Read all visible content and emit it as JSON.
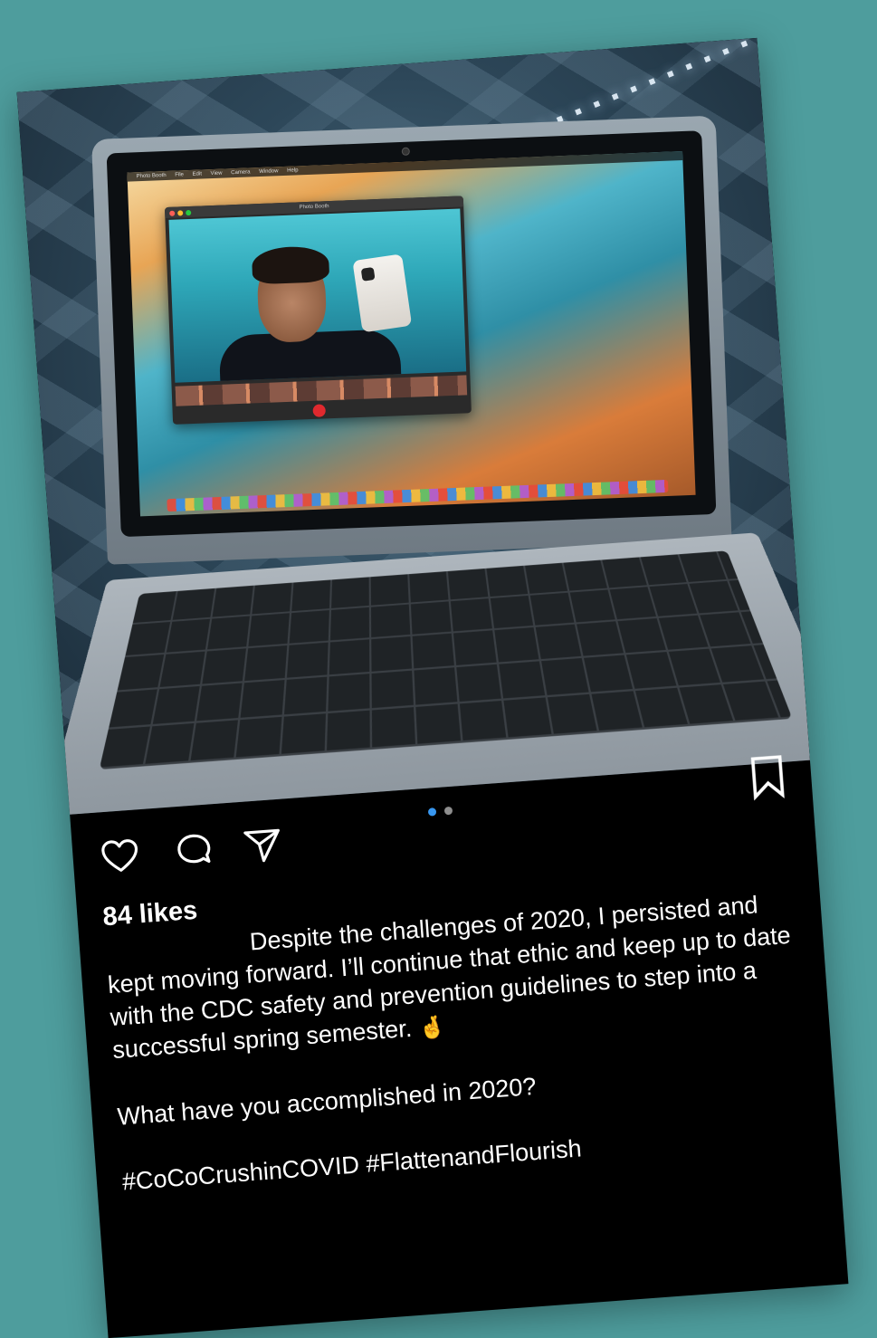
{
  "post": {
    "likes_text": "84 likes",
    "caption": "Despite the challenges of 2020, I persisted and kept moving forward. I’ll continue that ethic and keep up to date with the CDC safety and prevention guidelines to step into a successful spring semester.",
    "emoji": "🤞",
    "question": "What have you accomplished in 2020?",
    "hashtags": "#CoCoCrushinCOVID #FlattenandFlourish"
  },
  "photo_screen": {
    "menu_items": [
      "Photo Booth",
      "File",
      "Edit",
      "View",
      "Camera",
      "Window",
      "Help"
    ],
    "window_title": "Photo Booth"
  },
  "carousel": {
    "total": 2,
    "active": 0
  },
  "colors": {
    "background": "#4e9d9d",
    "card": "#000000",
    "active_dot": "#3897f0",
    "inactive_dot": "#8e8e8e"
  },
  "icons": {
    "like": "heart-icon",
    "comment": "comment-icon",
    "share": "send-icon",
    "save": "bookmark-icon"
  }
}
